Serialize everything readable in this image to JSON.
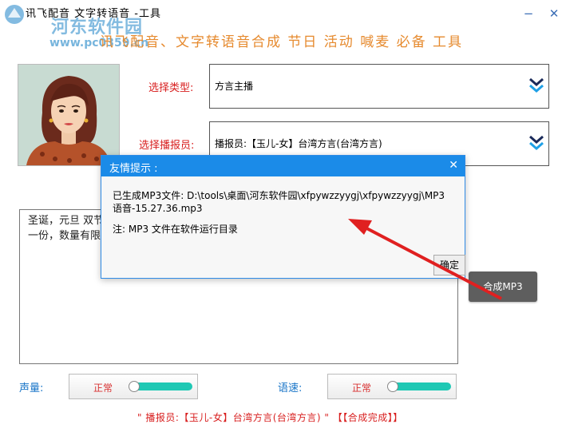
{
  "window": {
    "title": "讯飞配音 文字转语音 -工具",
    "minimize_glyph": "−",
    "close_glyph": "✕"
  },
  "watermark": {
    "name": "河东软件园",
    "url": "www.pc0359.cn"
  },
  "header": {
    "menu_line": "讯飞配音、文字转语音合成 节日 活动 喊麦  必备 工具"
  },
  "form": {
    "type_label": "选择类型:",
    "type_value": "方言主播",
    "anchor_label": "选择播报员:",
    "anchor_value": "播报员:【玉儿-女】台湾方言(台湾方言)"
  },
  "editor": {
    "text": "圣诞，元旦 双节同庆 全场8折 购物满百再抽奖，送时尚围巾一条，购买再抽奖，送精美礼品一份，数量有限，送完为止"
  },
  "actions": {
    "synthesize_label": "合成MP3"
  },
  "controls": {
    "volume_label": "声量:",
    "volume_value": "正常",
    "speed_label": "语速:",
    "speed_value": "正常"
  },
  "status": {
    "text": "\" 播报员:【玉儿-女】台湾方言(台湾方言) \"  【【合成完成】】"
  },
  "dialog": {
    "title": "友情提示 :",
    "close_glyph": "✕",
    "message": "已生成MP3文件: D:\\tools\\桌面\\河东软件园\\xfpywzzyygj\\xfpywzzyygj\\MP3语音-15.27.36.mp3",
    "note": "注:  MP3 文件在软件运行目录",
    "ok_label": "确定"
  },
  "colors": {
    "accent_blue": "#1b8be8",
    "label_red": "#d81e1e",
    "menu_orange": "#e68a2e",
    "slider_teal": "#1ec8b4",
    "arrow_red": "#e02020"
  },
  "icons": {
    "chevron": "double-chevron-down-icon",
    "arrow": "red-annotation-arrow"
  }
}
